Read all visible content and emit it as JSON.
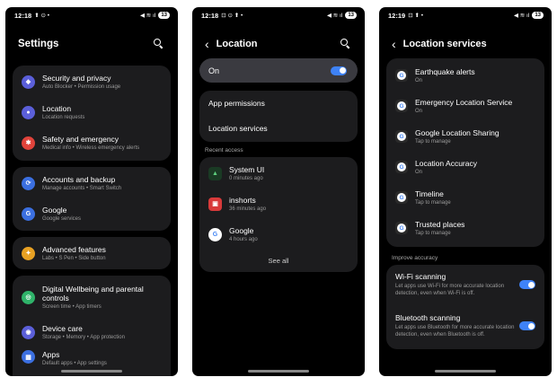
{
  "screens": [
    {
      "time": "12:18",
      "battery": "13",
      "title": "Settings",
      "groups": [
        [
          {
            "title": "Security and privacy",
            "subtitle": "Auto Blocker  •  Permission usage",
            "color": "#5b5fd9",
            "glyph": "◆"
          },
          {
            "title": "Location",
            "subtitle": "Location requests",
            "color": "#5b5fd9",
            "glyph": "●"
          },
          {
            "title": "Safety and emergency",
            "subtitle": "Medical info  •  Wireless emergency alerts",
            "color": "#e0433b",
            "glyph": "✱"
          }
        ],
        [
          {
            "title": "Accounts and backup",
            "subtitle": "Manage accounts  •  Smart Switch",
            "color": "#3b6fe0",
            "glyph": "⟳"
          },
          {
            "title": "Google",
            "subtitle": "Google services",
            "color": "#3b6fe0",
            "glyph": "G"
          }
        ],
        [
          {
            "title": "Advanced features",
            "subtitle": "Labs  •  S Pen  •  Side button",
            "color": "#e8a123",
            "glyph": "✦"
          }
        ],
        [
          {
            "title": "Digital Wellbeing and parental controls",
            "subtitle": "Screen time  •  App timers",
            "color": "#2fb36a",
            "glyph": "◎"
          },
          {
            "title": "Device care",
            "subtitle": "Storage  •  Memory  •  App protection",
            "color": "#5b5fd9",
            "glyph": "◉"
          },
          {
            "title": "Apps",
            "subtitle": "Default apps  •  App settings",
            "color": "#3b6fe0",
            "glyph": "▦"
          }
        ]
      ]
    },
    {
      "time": "12:18",
      "battery": "13",
      "title": "Location",
      "master_toggle_label": "On",
      "links": [
        "App permissions",
        "Location services"
      ],
      "recent_label": "Recent access",
      "recent": [
        {
          "title": "System UI",
          "subtitle": "0 minutes ago"
        },
        {
          "title": "inshorts",
          "subtitle": "36 minutes ago"
        },
        {
          "title": "Google",
          "subtitle": "4 hours ago"
        }
      ],
      "see_all": "See all"
    },
    {
      "time": "12:19",
      "battery": "13",
      "title": "Location services",
      "services": [
        {
          "title": "Earthquake alerts",
          "subtitle": "On"
        },
        {
          "title": "Emergency Location Service",
          "subtitle": "On"
        },
        {
          "title": "Google Location Sharing",
          "subtitle": "Tap to manage"
        },
        {
          "title": "Location Accuracy",
          "subtitle": "On"
        },
        {
          "title": "Timeline",
          "subtitle": "Tap to manage"
        },
        {
          "title": "Trusted places",
          "subtitle": "Tap to manage"
        }
      ],
      "improve_label": "Improve accuracy",
      "scanning": [
        {
          "title": "Wi-Fi scanning",
          "subtitle": "Let apps use Wi-Fi for more accurate location detection, even when Wi-Fi is off."
        },
        {
          "title": "Bluetooth scanning",
          "subtitle": "Let apps use Bluetooth for more accurate location detection, even when Bluetooth is off."
        }
      ]
    }
  ],
  "accent": "#3e82f7"
}
